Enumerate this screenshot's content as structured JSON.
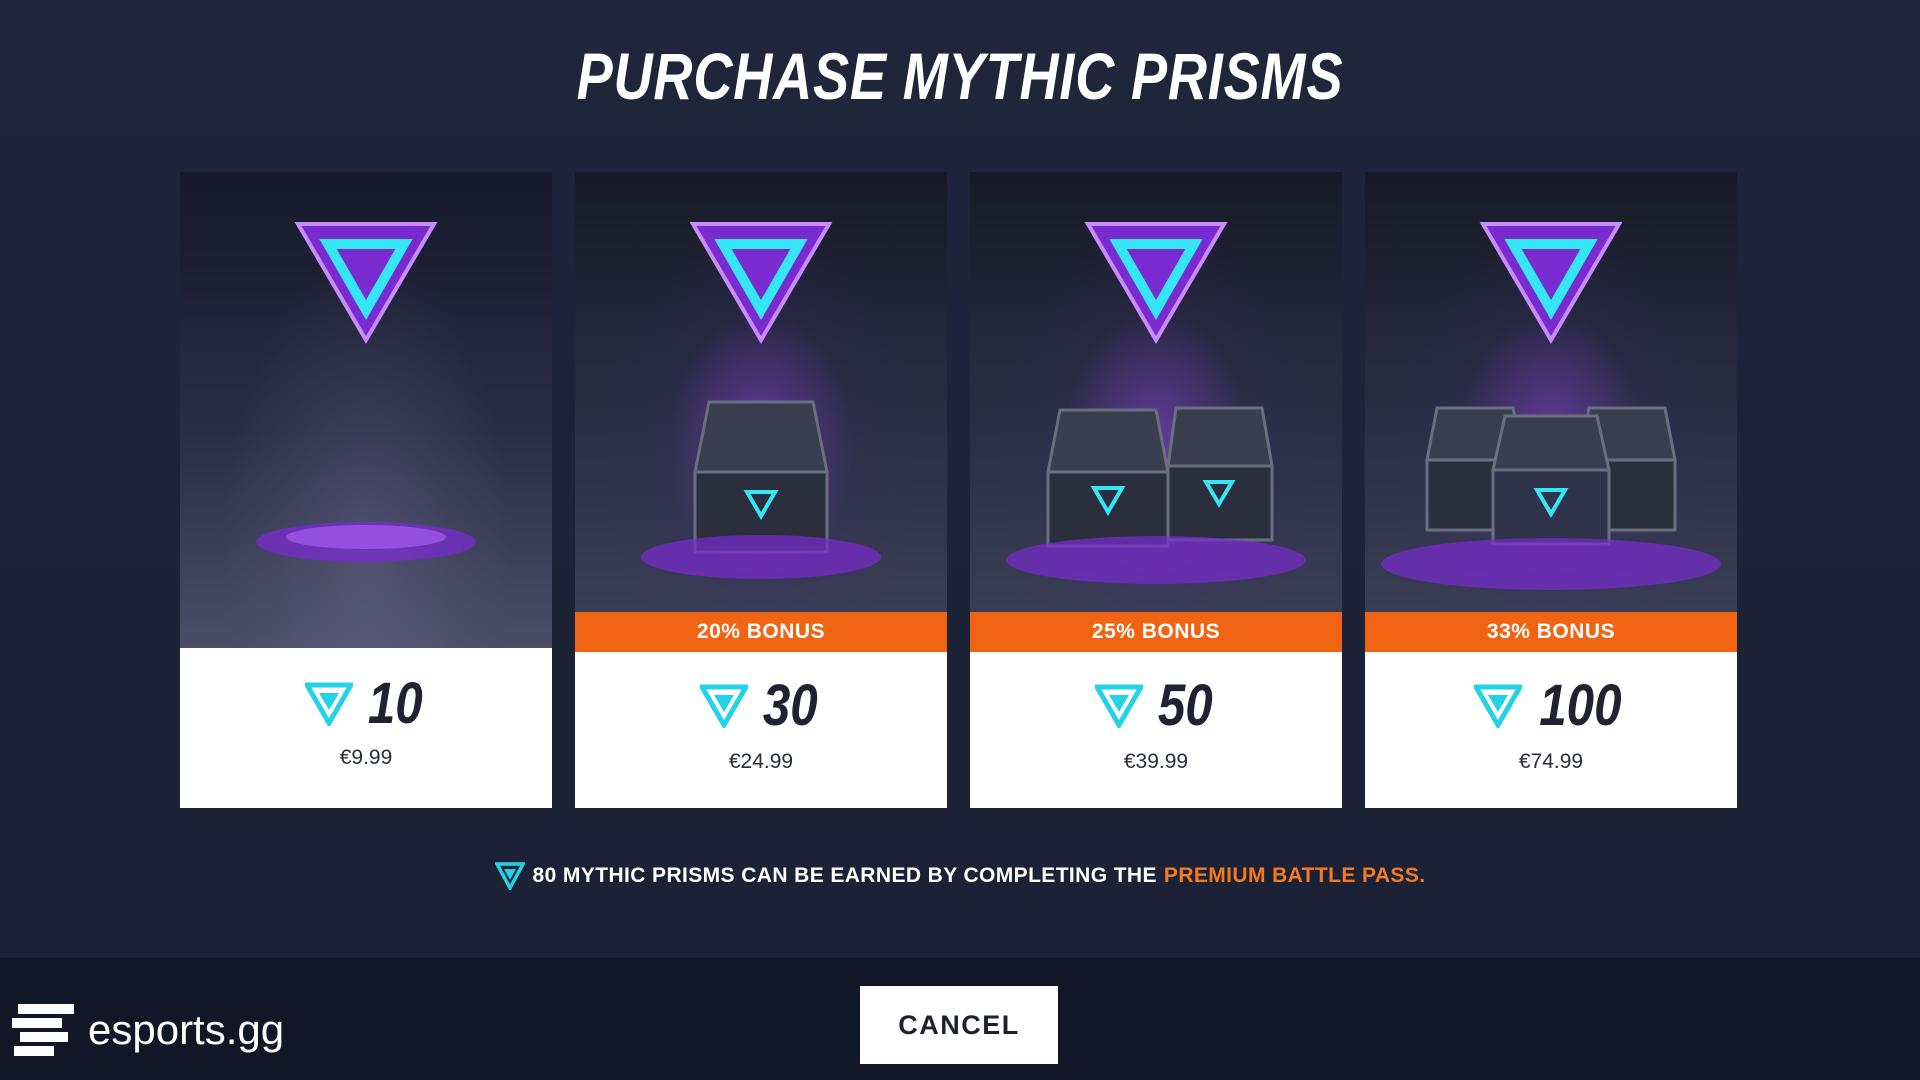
{
  "page": {
    "title": "PURCHASE MYTHIC PRISMS"
  },
  "offers": [
    {
      "amount": "10",
      "price": "€9.99",
      "bonus": ""
    },
    {
      "amount": "30",
      "price": "€24.99",
      "bonus": "20% BONUS"
    },
    {
      "amount": "50",
      "price": "€39.99",
      "bonus": "25% BONUS"
    },
    {
      "amount": "100",
      "price": "€74.99",
      "bonus": "33% BONUS"
    }
  ],
  "note": {
    "text": "80 MYTHIC PRISMS CAN BE EARNED BY COMPLETING THE",
    "highlight": "PREMIUM BATTLE PASS."
  },
  "footer": {
    "cancel_label": "CANCEL",
    "watermark": "esports.gg"
  },
  "colors": {
    "background": "#1c2236",
    "bonus": "#f06414",
    "prism_cyan": "#22d3e8",
    "prism_purple": "#8b2fe0",
    "highlight": "#f57a20"
  },
  "icons": {
    "prism": "mythic-prism-icon",
    "logo": "esports-gg-logo-icon"
  }
}
